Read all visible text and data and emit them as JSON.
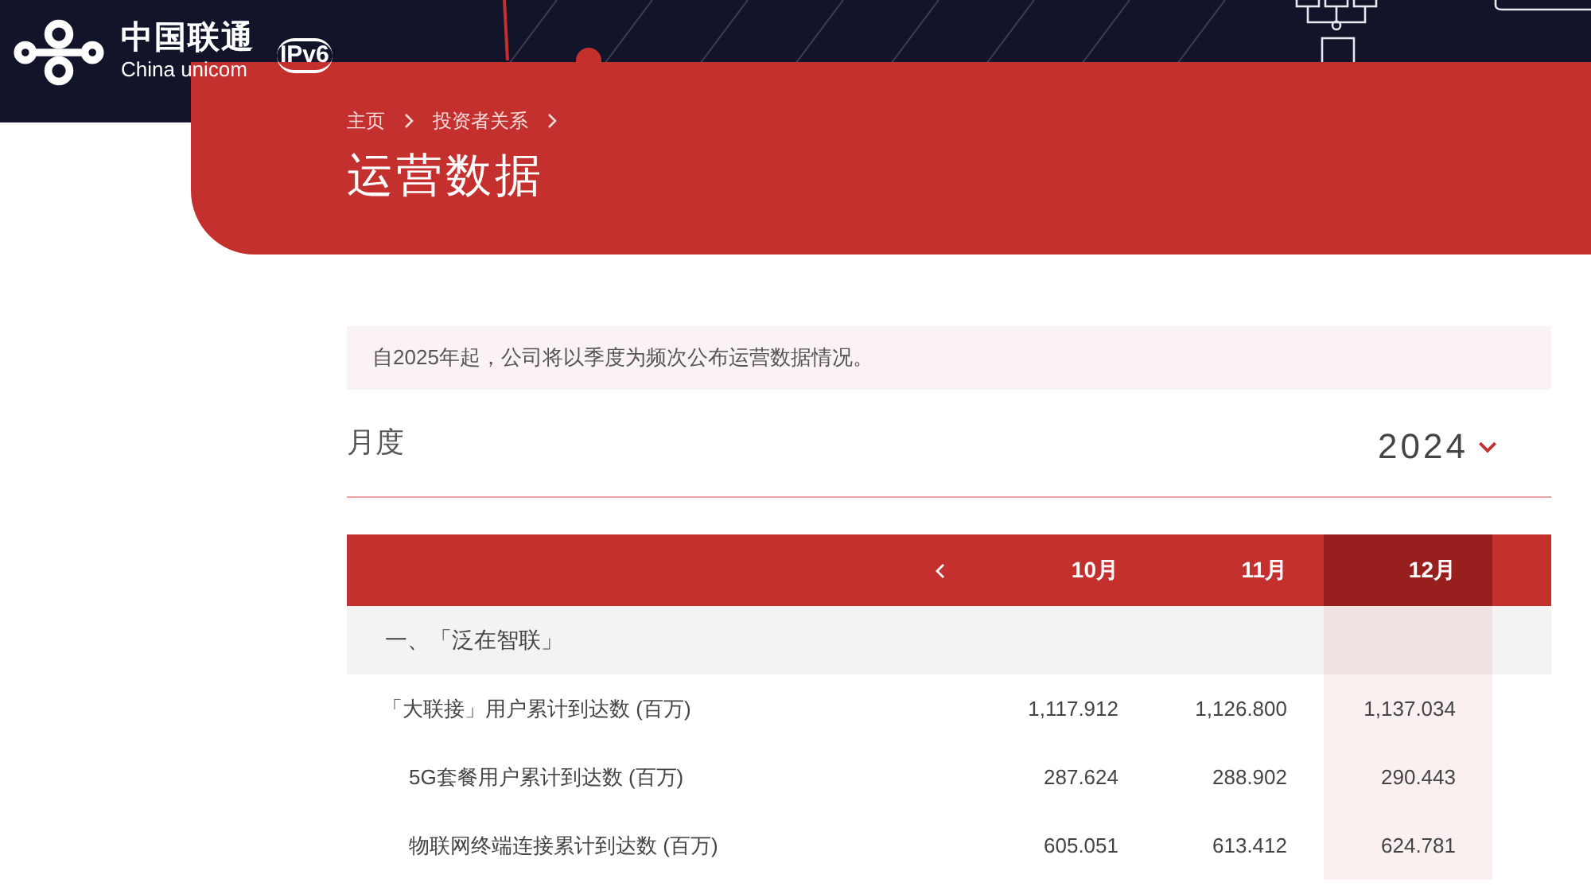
{
  "header": {
    "brand_cn": "中国联通",
    "brand_en": "China unicom",
    "badge": "IPv6"
  },
  "banner": {
    "breadcrumb": [
      "主页",
      "投资者关系"
    ],
    "title": "运营数据"
  },
  "notice": "自2025年起，公司将以季度为频次公布运营数据情况。",
  "period": {
    "label": "月度",
    "year": "2024"
  },
  "table": {
    "columns": [
      {
        "label": "10月",
        "selected": false
      },
      {
        "label": "11月",
        "selected": false
      },
      {
        "label": "12月",
        "selected": true
      }
    ],
    "rows": [
      {
        "kind": "group",
        "label": "一、「泛在智联」",
        "children": [
          {
            "kind": "metric",
            "label": "「大联接」用户累计到达数 (百万)",
            "values": [
              "1,117.912",
              "1,126.800",
              "1,137.034"
            ],
            "children": [
              {
                "kind": "metric",
                "label": "5G套餐用户累计到达数 (百万)",
                "values": [
                  "287.624",
                  "288.902",
                  "290.443"
                ]
              },
              {
                "kind": "metric",
                "label": "物联网终端连接累计到达数 (百万)",
                "values": [
                  "605.051",
                  "613.412",
                  "624.781"
                ]
              }
            ]
          }
        ]
      }
    ]
  }
}
